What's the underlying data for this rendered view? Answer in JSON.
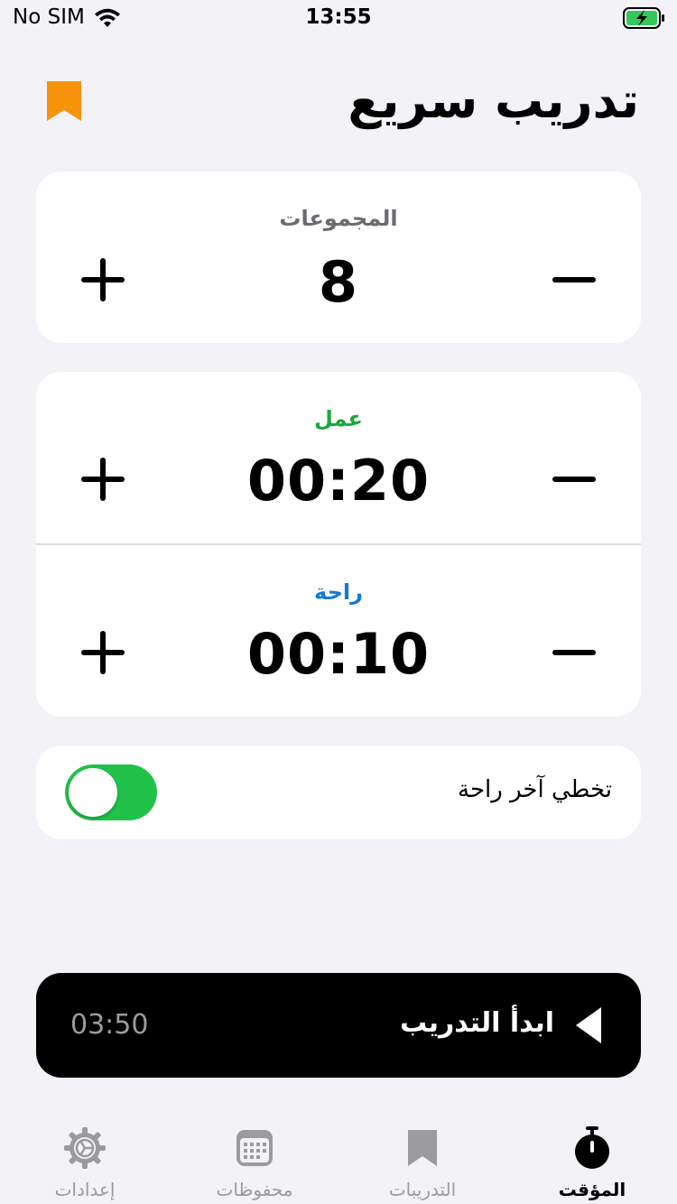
{
  "status_bar": {
    "carrier": "No SIM",
    "time": "13:55"
  },
  "header": {
    "title": "تدريب سريع"
  },
  "sets": {
    "label": "المجموعات",
    "value": "8"
  },
  "work": {
    "label": "عمل",
    "value": "00:20",
    "color": "#1aa83e"
  },
  "rest": {
    "label": "راحة",
    "value": "00:10",
    "color": "#1479d4"
  },
  "skip_last_rest": {
    "label": "تخطي آخر راحة",
    "enabled": true
  },
  "start": {
    "label": "ابدأ التدريب",
    "total_time": "03:50"
  },
  "colors": {
    "accent": "#f7930a",
    "switch_on": "#21c24a",
    "background": "#f2f2f7"
  },
  "tabs": [
    {
      "label": "إعدادات",
      "icon": "gear-icon",
      "active": false
    },
    {
      "label": "محفوظات",
      "icon": "calendar-grid-icon",
      "active": false
    },
    {
      "label": "التدريبات",
      "icon": "bookmark-icon",
      "active": false
    },
    {
      "label": "المؤقت",
      "icon": "stopwatch-icon",
      "active": true
    }
  ]
}
